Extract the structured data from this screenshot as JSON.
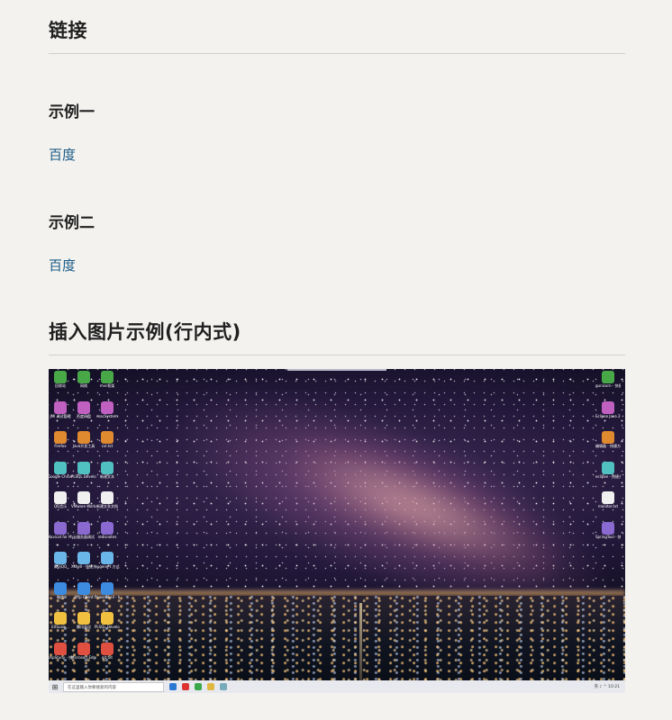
{
  "sections": {
    "links_title": "链接",
    "example1_title": "示例一",
    "example1_link": "百度",
    "example2_title": "示例二",
    "example2_link": "百度",
    "image_title": "插入图片示例(行内式)"
  },
  "desktop": {
    "left_icons_col1": [
      "回收站",
      "JMI 调试管理",
      "Firefox",
      "Google Chrome",
      "QQ音乐",
      "Navicat for MySQL",
      "腾讯QQ",
      "微信",
      "EXScale...",
      "phpStudy - 快捷方式"
    ],
    "left_icons_col2": [
      "网络",
      "百度网盘",
      "Java开发工具",
      "PLSQL Developer",
      "VMware Workstation",
      "云服务器调试",
      "Xshell - 快捷方式",
      "Xftp Client",
      "腾讯会议",
      "Microsoft Edge"
    ],
    "left_icons_col3": [
      "mvc框架",
      "macSystem",
      "cxl.txt",
      "新建文本",
      "新建文本文档",
      "redisnotes",
      "eugene-t 方式",
      "PowerShell - Integrate...",
      "PLSQL Developer",
      "git.txt"
    ],
    "right_icons": [
      "gunicorn - 快捷方式",
      "Eclipse Java 2019-09",
      "编辑器 - 快捷方式",
      "eclipse - 快捷方式",
      "monitor.txt",
      "SpringTool - 快捷方式"
    ],
    "taskbar_search_placeholder": "在这里输入你要搜索的内容",
    "tray_text": "英 ♪ ^  10:21"
  },
  "colors": {
    "link": "#1a5a86",
    "background": "#f3f2ef"
  }
}
